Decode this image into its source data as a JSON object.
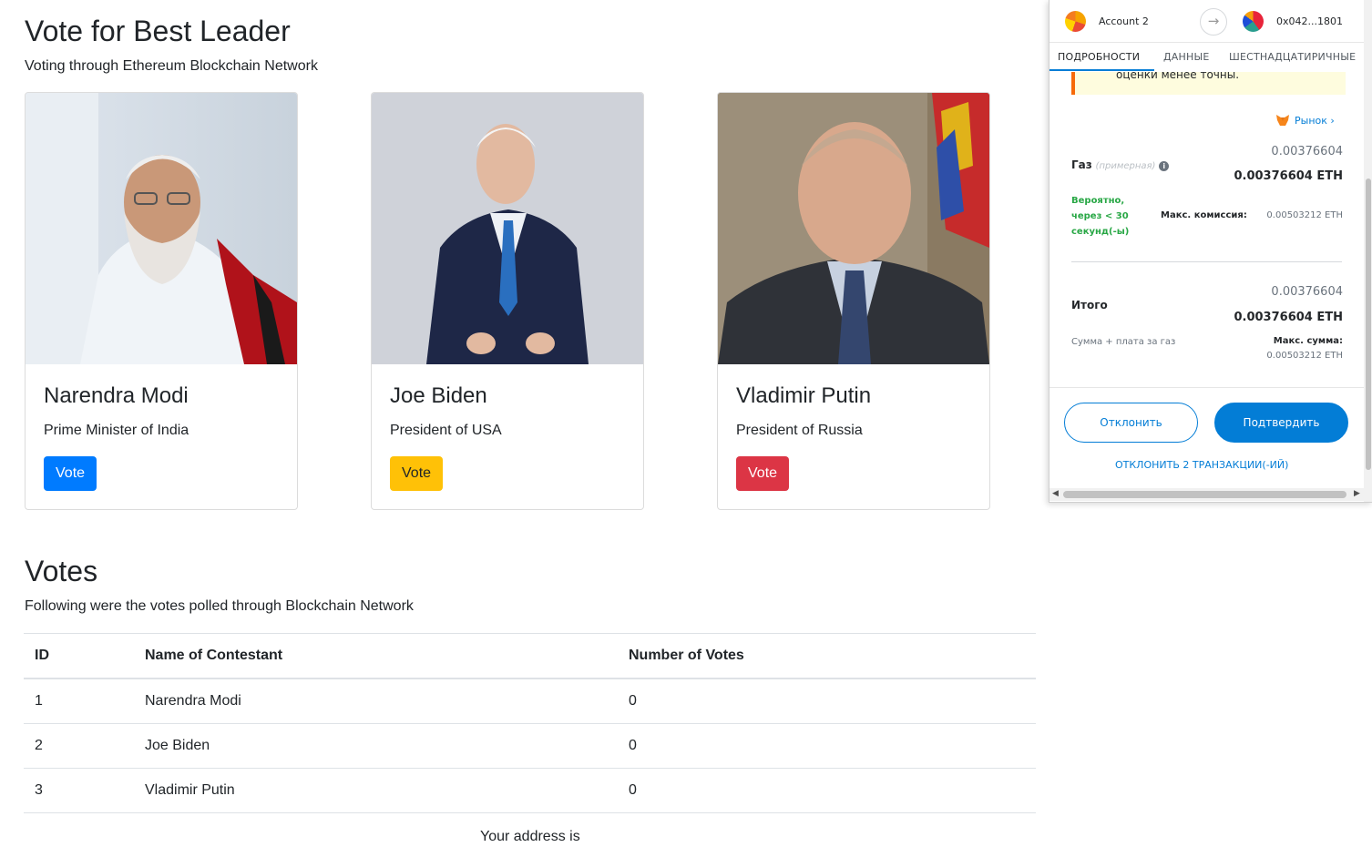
{
  "page": {
    "title": "Vote for Best Leader",
    "subtitle": "Voting through Ethereum Blockchain Network"
  },
  "candidates": [
    {
      "name": "Narendra Modi",
      "role": "Prime Minister of India",
      "button": "Vote",
      "button_color": "#007bff"
    },
    {
      "name": "Joe Biden",
      "role": "President of USA",
      "button": "Vote",
      "button_color": "#ffc107"
    },
    {
      "name": "Vladimir Putin",
      "role": "President of Russia",
      "button": "Vote",
      "button_color": "#dc3545"
    }
  ],
  "votes": {
    "title": "Votes",
    "subtitle": "Following were the votes polled through Blockchain Network",
    "columns": [
      "ID",
      "Name of Contestant",
      "Number of Votes"
    ],
    "rows": [
      [
        "1",
        "Narendra Modi",
        "0"
      ],
      [
        "2",
        "Joe Biden",
        "0"
      ],
      [
        "3",
        "Vladimir Putin",
        "0"
      ]
    ]
  },
  "address_text": "Your address is",
  "metamask": {
    "account": "Account 2",
    "to_address": "0x042...1801",
    "tabs": [
      "ПОДРОБНОСТИ",
      "ДАННЫЕ",
      "ШЕСТНАДЦАТИРИЧНЫЕ"
    ],
    "warning_text": "оценки менее точны.",
    "market_link": "Рынок",
    "gas_label": "Газ",
    "gas_hint": "(примерная)",
    "gas_value": "0.00376604",
    "gas_value_eth": "0.00376604 ETH",
    "likely": "Вероятно, через < 30 секунд(-ы)",
    "max_fee_label": "Макс. комиссия:",
    "max_fee_value": "0.00503212 ETH",
    "total_label": "Итого",
    "total_value": "0.00376604",
    "total_value_eth": "0.00376604 ETH",
    "sum_label": "Сумма + плата за газ",
    "max_sum_label": "Макс. сумма:",
    "max_sum_value": "0.00503212 ETH",
    "reject_button": "Отклонить",
    "confirm_button": "Подтвердить",
    "reject_all": "ОТКЛОНИТЬ 2 ТРАНЗАКЦИИ(-ИЙ)",
    "accent_color": "#037dd6"
  }
}
